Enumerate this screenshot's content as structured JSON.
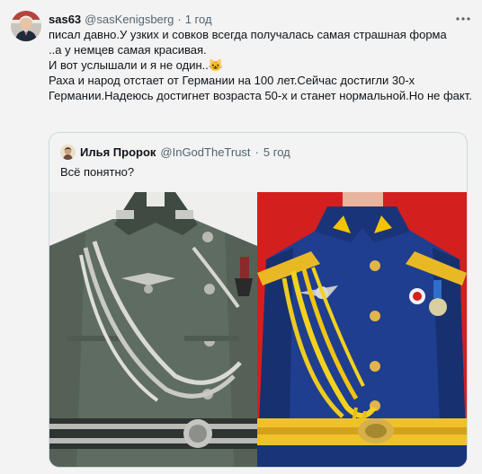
{
  "tweet": {
    "name": "sas63",
    "handle": "@sasKenigsberg",
    "separator": "·",
    "time": "1 год",
    "lines": [
      "писал давно.У узких и совков всегда получалась самая страшная форма",
      "..а у немцев самая красивая.",
      "И вот услышали и я не один..",
      "Раха и народ отстает от Германии на 100 лет.Сейчас достигли 30-х Германии.Надеюсь достигнет возраста 50-х и станет нормальной.Но не факт."
    ],
    "emoji": "😺"
  },
  "quote": {
    "name": "Илья Пророк",
    "handle": "@InGodTheTrust",
    "separator": "·",
    "time": "5 год",
    "text": "Всё понятно?"
  },
  "icons": {
    "more": "more-options-icon",
    "avatar": "avatar",
    "quote_avatar": "quote-avatar"
  },
  "colors": {
    "background": "#f3f3f3",
    "secondary_text": "#536471",
    "border": "#cfd9de",
    "right_photo_bg": "#d41f1f"
  }
}
